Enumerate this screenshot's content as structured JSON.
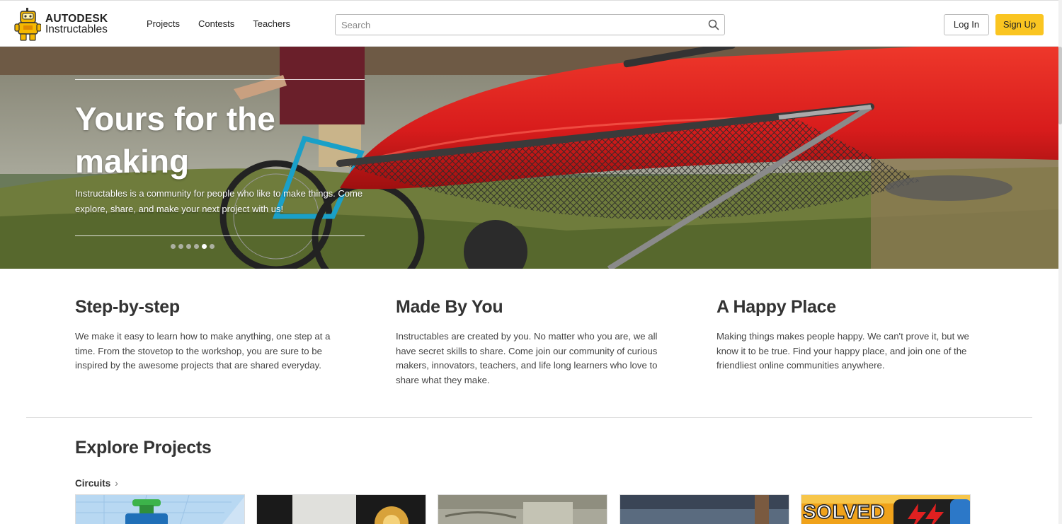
{
  "header": {
    "logo_top": "AUTODESK",
    "logo_bottom": "Instructables",
    "nav": [
      "Projects",
      "Contests",
      "Teachers"
    ],
    "search_placeholder": "Search",
    "login_label": "Log In",
    "signup_label": "Sign Up"
  },
  "hero": {
    "title": "Yours for the making",
    "description": "Instructables is a community for people who like to make things. Come explore, share, and make your next project with us!",
    "slides": 6,
    "active_slide": 5
  },
  "features": [
    {
      "title": "Step-by-step",
      "text": "We make it easy to learn how to make anything, one step at a time. From the stovetop to the workshop, you are sure to be inspired by the awesome projects that are shared everyday."
    },
    {
      "title": "Made By You",
      "text": "Instructables are created by you. No matter who you are, we all have secret skills to share. Come join our community of curious makers, innovators, teachers, and life long learners who love to share what they make."
    },
    {
      "title": "A Happy Place",
      "text": "Making things makes people happy. We can't prove it, but we know it to be true. Find your happy place, and join one of the friendliest online communities anywhere."
    }
  ],
  "explore": {
    "title": "Explore Projects",
    "category": "Circuits",
    "card_text": "SOLVED"
  },
  "colors": {
    "accent": "#fac521",
    "text": "#333333",
    "kayak": "#e01f1f"
  }
}
